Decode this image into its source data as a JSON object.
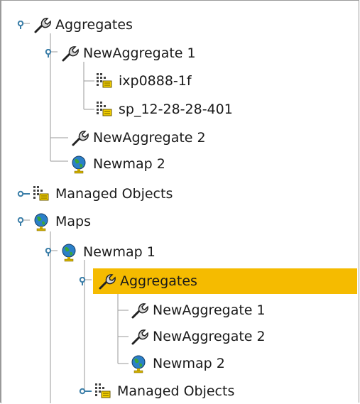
{
  "tree": {
    "nodes": [
      {
        "id": "n0",
        "label": "Aggregates",
        "icon": "wrench-icon",
        "expanded": true
      },
      {
        "id": "n1",
        "label": "NewAggregate 1",
        "icon": "wrench-icon",
        "expanded": true
      },
      {
        "id": "n2",
        "label": "ixp0888-1f",
        "icon": "managed-object-icon"
      },
      {
        "id": "n3",
        "label": "sp_12-28-28-401",
        "icon": "managed-object-icon"
      },
      {
        "id": "n4",
        "label": "NewAggregate 2",
        "icon": "wrench-icon"
      },
      {
        "id": "n5",
        "label": "Newmap 2",
        "icon": "globe-icon"
      },
      {
        "id": "n6",
        "label": "Managed Objects",
        "icon": "managed-object-icon",
        "expanded": false
      },
      {
        "id": "n7",
        "label": "Maps",
        "icon": "globe-icon",
        "expanded": true
      },
      {
        "id": "n8",
        "label": "Newmap 1",
        "icon": "globe-icon",
        "expanded": true
      },
      {
        "id": "n9",
        "label": "Aggregates",
        "icon": "wrench-icon",
        "expanded": true,
        "selected": true
      },
      {
        "id": "n10",
        "label": "NewAggregate 1",
        "icon": "wrench-icon"
      },
      {
        "id": "n11",
        "label": "NewAggregate 2",
        "icon": "wrench-icon"
      },
      {
        "id": "n12",
        "label": "Newmap 2",
        "icon": "globe-icon"
      },
      {
        "id": "n13",
        "label": "Managed Objects",
        "icon": "managed-object-icon",
        "expanded": false
      }
    ]
  },
  "colors": {
    "selection": "#f5bb00",
    "tree_line": "#9a9a9a",
    "handle": "#3b7ea8"
  }
}
